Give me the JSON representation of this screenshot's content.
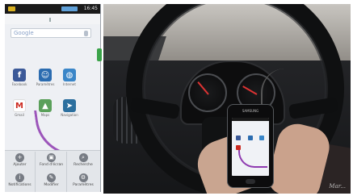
{
  "phone_screen": {
    "status_time": "16:45",
    "apps": [
      {
        "label": "Facebook",
        "icon": "facebook-icon",
        "color": "#3b5998",
        "glyph": "f"
      },
      {
        "label": "Paramètres",
        "icon": "settings-icon",
        "color": "#2b6cb0",
        "glyph": "☺"
      },
      {
        "label": "Internet",
        "icon": "globe-icon",
        "color": "#3a86c8",
        "glyph": "◍"
      },
      {
        "label": "Gmail",
        "icon": "gmail-icon",
        "color": "#ffffff",
        "glyph": "M"
      },
      {
        "label": "Maps",
        "icon": "maps-icon",
        "color": "#5aa05a",
        "glyph": "▲"
      },
      {
        "label": "Navigation",
        "icon": "navigation-icon",
        "color": "#2c6f9e",
        "glyph": "➤"
      }
    ],
    "menu": [
      {
        "label": "Ajouter",
        "icon": "add-icon",
        "glyph": "+"
      },
      {
        "label": "Fond d'écran",
        "icon": "wallpaper-icon",
        "glyph": "▣"
      },
      {
        "label": "Recherche",
        "icon": "search-icon",
        "glyph": "⌕"
      },
      {
        "label": "Notifications",
        "icon": "notifications-icon",
        "glyph": "i"
      },
      {
        "label": "Modifier",
        "icon": "edit-icon",
        "glyph": "✎"
      },
      {
        "label": "Paramètres",
        "icon": "settings-icon",
        "glyph": "⚙"
      }
    ]
  },
  "photo": {
    "watermark": "Mar..."
  },
  "colors": {
    "swipe": "#8e3ab0",
    "dashboard": "#1e1f21"
  }
}
